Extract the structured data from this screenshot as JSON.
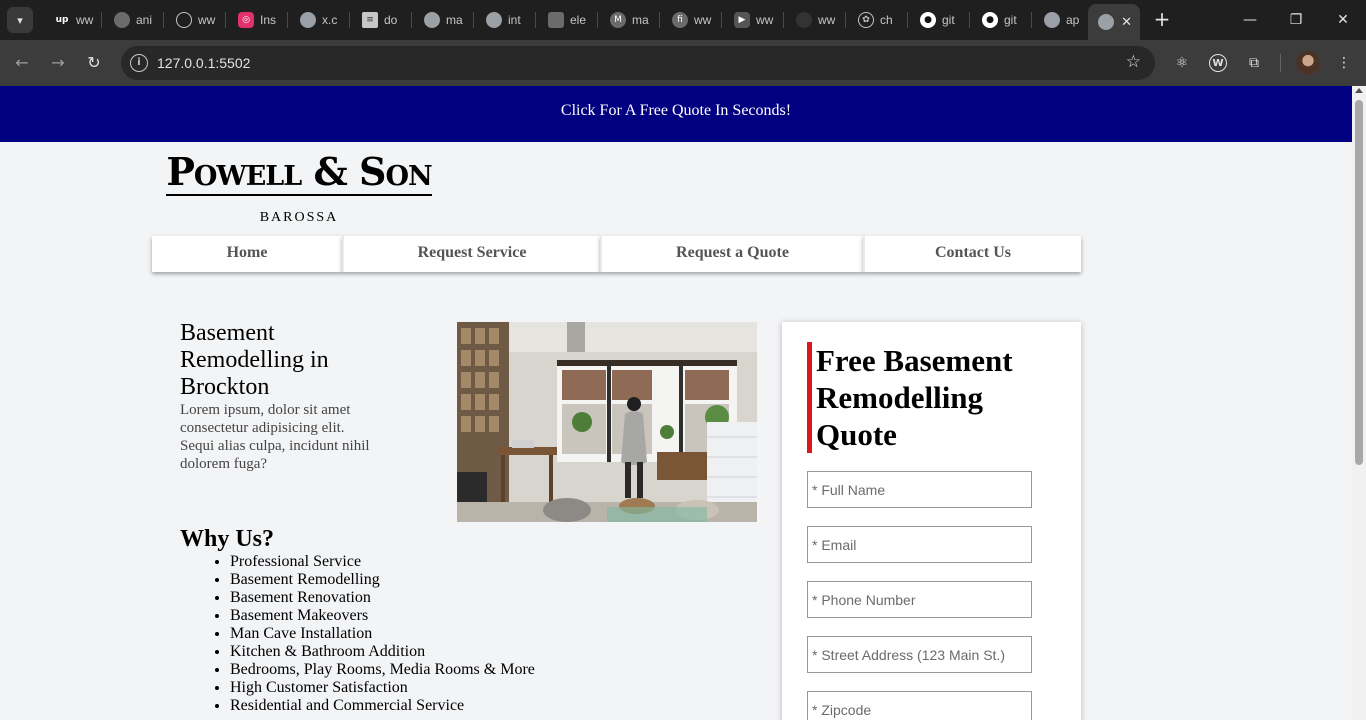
{
  "browser": {
    "tabs": [
      {
        "label": "ww",
        "icon": "upwork-icon",
        "color": "#6fda44"
      },
      {
        "label": "ani",
        "icon": "app-icon",
        "color": "#888888"
      },
      {
        "label": "ww",
        "icon": "app-icon",
        "color": "#888888"
      },
      {
        "label": "Ins",
        "icon": "instagram-icon",
        "color": "#e1306c"
      },
      {
        "label": "x.c",
        "icon": "globe-icon",
        "color": "#9aa0a6"
      },
      {
        "label": "do",
        "icon": "docs-icon",
        "color": "#c4c7c5"
      },
      {
        "label": "ma",
        "icon": "globe-icon",
        "color": "#9aa0a6"
      },
      {
        "label": "int",
        "icon": "globe-icon",
        "color": "#9aa0a6"
      },
      {
        "label": "ele",
        "icon": "app-icon",
        "color": "#888888"
      },
      {
        "label": "ma",
        "icon": "app-icon",
        "color": "#888888"
      },
      {
        "label": "ww",
        "icon": "app-icon",
        "color": "#888888"
      },
      {
        "label": "ww",
        "icon": "youtube-icon",
        "color": "#555555"
      },
      {
        "label": "ww",
        "icon": "app-icon",
        "color": "#444444"
      },
      {
        "label": "ch",
        "icon": "openai-icon",
        "color": "#c4c7c5"
      },
      {
        "label": "git",
        "icon": "github-icon",
        "color": "#ffffff"
      },
      {
        "label": "git",
        "icon": "github-icon",
        "color": "#ffffff"
      },
      {
        "label": "ap",
        "icon": "globe-icon",
        "color": "#9aa0a6"
      }
    ],
    "url": "127.0.0.1:5502"
  },
  "promo": {
    "text": "Click For A Free Quote In Seconds!",
    "background": "#000080"
  },
  "logo": {
    "name": "Powell & Son",
    "subtitle": "BAROSSA"
  },
  "nav": {
    "items": [
      "Home",
      "Request Service",
      "Request a Quote",
      "Contact Us"
    ]
  },
  "intro": {
    "heading": "Basement Remodelling in Brockton",
    "body": "Lorem ipsum, dolor sit amet consectetur adipisicing elit. Sequi alias culpa, incidunt nihil dolorem fuga?"
  },
  "why": {
    "heading": "Why Us?",
    "items": [
      "Professional Service",
      "Basement Remodelling",
      "Basement Renovation",
      "Basement Makeovers",
      "Man Cave Installation",
      "Kitchen & Bathroom Addition",
      "Bedrooms, Play Rooms, Media Rooms & More",
      "High Customer Satisfaction",
      "Residential and Commercial Service"
    ]
  },
  "quote_form": {
    "title": "Free Basement Remodelling Quote",
    "accent": "#e0161e",
    "fields": [
      {
        "placeholder": "* Full Name",
        "value": ""
      },
      {
        "placeholder": "* Email",
        "value": ""
      },
      {
        "placeholder": "* Phone Number",
        "value": ""
      },
      {
        "placeholder": "* Street Address (123 Main St.)",
        "value": ""
      },
      {
        "placeholder": "* Zipcode",
        "value": ""
      }
    ]
  }
}
